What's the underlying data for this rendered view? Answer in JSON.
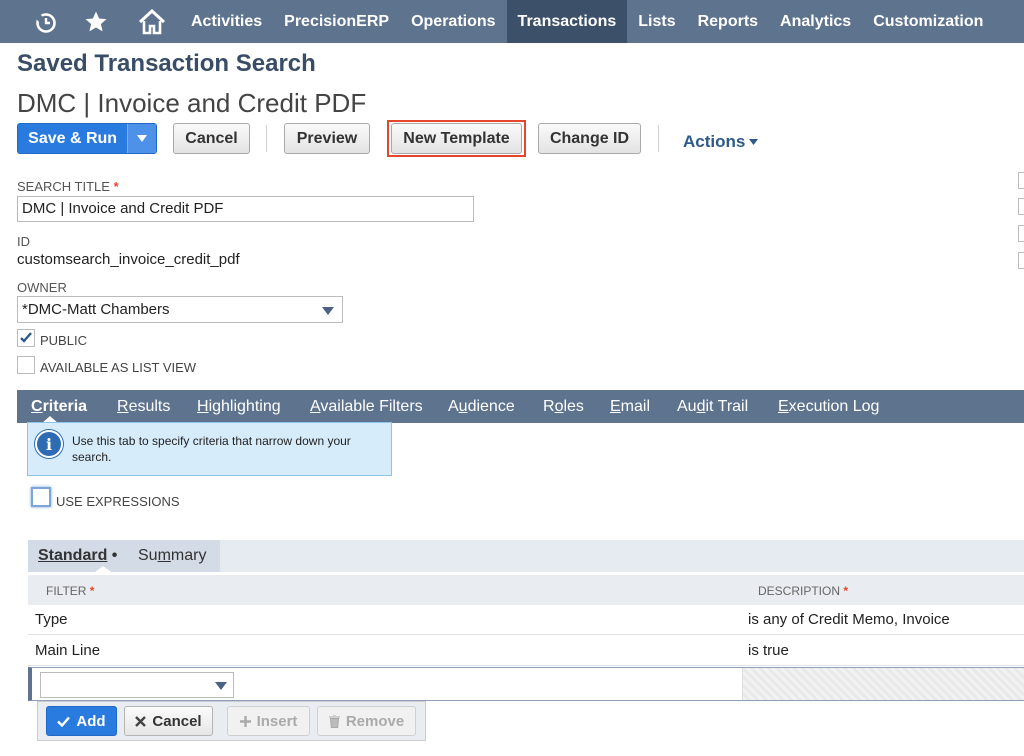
{
  "nav": {
    "icons": [
      "recent-icon",
      "star-icon",
      "home-icon"
    ],
    "items": [
      "Activities",
      "PrecisionERP",
      "Operations",
      "Transactions",
      "Lists",
      "Reports",
      "Analytics",
      "Customization"
    ],
    "active": "Transactions"
  },
  "page": {
    "type": "Saved Transaction Search",
    "title": "DMC | Invoice and Credit PDF"
  },
  "toolbar": {
    "save_run": "Save & Run",
    "cancel": "Cancel",
    "preview": "Preview",
    "new_template": "New Template",
    "change_id": "Change ID",
    "actions": "Actions"
  },
  "form": {
    "search_title_label": "SEARCH TITLE",
    "search_title_value": "DMC | Invoice and Credit PDF",
    "id_label": "ID",
    "id_value": "customsearch_invoice_credit_pdf",
    "owner_label": "OWNER",
    "owner_value": "*DMC-Matt Chambers",
    "public_label": "PUBLIC",
    "public_checked": true,
    "list_view_label": "AVAILABLE AS LIST VIEW",
    "list_view_checked": false
  },
  "tabs": [
    {
      "key": "C",
      "rest": "riteria",
      "active": true
    },
    {
      "key": "R",
      "rest": "esults",
      "active": false
    },
    {
      "key": "H",
      "rest": "ighlighting",
      "active": false
    },
    {
      "key": "A",
      "rest": "vailable Filters",
      "active": false
    },
    {
      "key": "Au",
      "rest": "dience",
      "active": false
    },
    {
      "key": "Ro",
      "rest": "les",
      "active": false
    },
    {
      "key": "E",
      "rest": "mail",
      "active": false
    },
    {
      "key": "Audit Trail",
      "rest": "",
      "active": false
    },
    {
      "key": "E",
      "rest": "xecution Log",
      "active": false
    }
  ],
  "tab_labels": [
    "Criteria",
    "Results",
    "Highlighting",
    "Available Filters",
    "Audience",
    "Roles",
    "Email",
    "Audit Trail",
    "Execution Log"
  ],
  "info": {
    "text": "Use this tab to specify criteria that narrow down your search."
  },
  "use_expressions_label": "USE EXPRESSIONS",
  "subtabs": {
    "standard": "Standard",
    "summary": "Summary"
  },
  "grid": {
    "col_filter": "FILTER",
    "col_description": "DESCRIPTION",
    "rows": [
      {
        "filter": "Type",
        "description": "is any of Credit Memo, Invoice"
      },
      {
        "filter": "Main Line",
        "description": "is true"
      }
    ]
  },
  "row_buttons": {
    "add": "Add",
    "cancel": "Cancel",
    "insert": "Insert",
    "remove": "Remove"
  },
  "colors": {
    "nav_bg": "#5e738e",
    "nav_active": "#3c5069",
    "primary": "#2a7be0",
    "highlight": "#e5462e"
  }
}
